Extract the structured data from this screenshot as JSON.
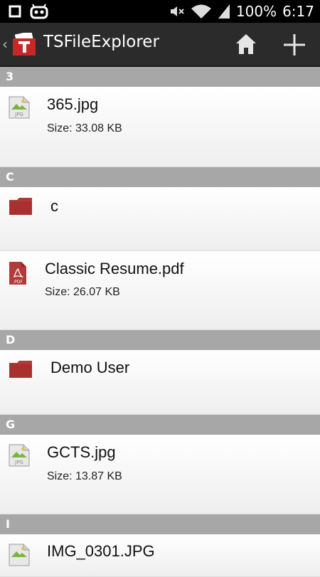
{
  "status_bar": {
    "battery": "100%",
    "time": "6:17"
  },
  "action_bar": {
    "title": "TSFileExplorer"
  },
  "sections": [
    {
      "letter": "3",
      "items": [
        {
          "name": "365.jpg",
          "size": "Size: 33.08 KB",
          "icon": "jpg-file-icon"
        }
      ]
    },
    {
      "letter": "C",
      "items": [
        {
          "name": "c",
          "size": "",
          "icon": "folder-icon"
        },
        {
          "name": "Classic Resume.pdf",
          "size": "Size: 26.07 KB",
          "icon": "pdf-file-icon"
        }
      ]
    },
    {
      "letter": "D",
      "items": [
        {
          "name": "Demo User",
          "size": "",
          "icon": "folder-icon"
        }
      ]
    },
    {
      "letter": "G",
      "items": [
        {
          "name": "GCTS.jpg",
          "size": "Size: 13.87 KB",
          "icon": "jpg-file-icon"
        }
      ]
    },
    {
      "letter": "I",
      "items": [
        {
          "name": "IMG_0301.JPG",
          "size": "",
          "icon": "jpg-file-icon"
        }
      ]
    }
  ],
  "colors": {
    "folder": "#b23a3a",
    "header_bg": "#a7a7a7",
    "action_bar_bg": "#2b2b2b"
  }
}
